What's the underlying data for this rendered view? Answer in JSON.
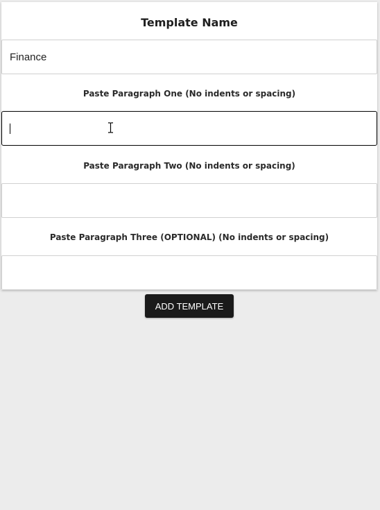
{
  "form": {
    "title": "Template Name",
    "template_name_value": "Finance",
    "paragraph_one_label": "Paste Paragraph One (No indents or spacing)",
    "paragraph_one_value": "",
    "paragraph_two_label": "Paste Paragraph Two (No indents or spacing)",
    "paragraph_two_value": "",
    "paragraph_three_label": "Paste Paragraph Three (OPTIONAL) (No indents or spacing)",
    "paragraph_three_value": "",
    "submit_label": "ADD TEMPLATE"
  },
  "colors": {
    "background": "#ececec",
    "card": "#ffffff",
    "button": "#1a1a1a",
    "active_border": "#000000"
  },
  "icons": {
    "cursor": "text-cursor-icon"
  }
}
